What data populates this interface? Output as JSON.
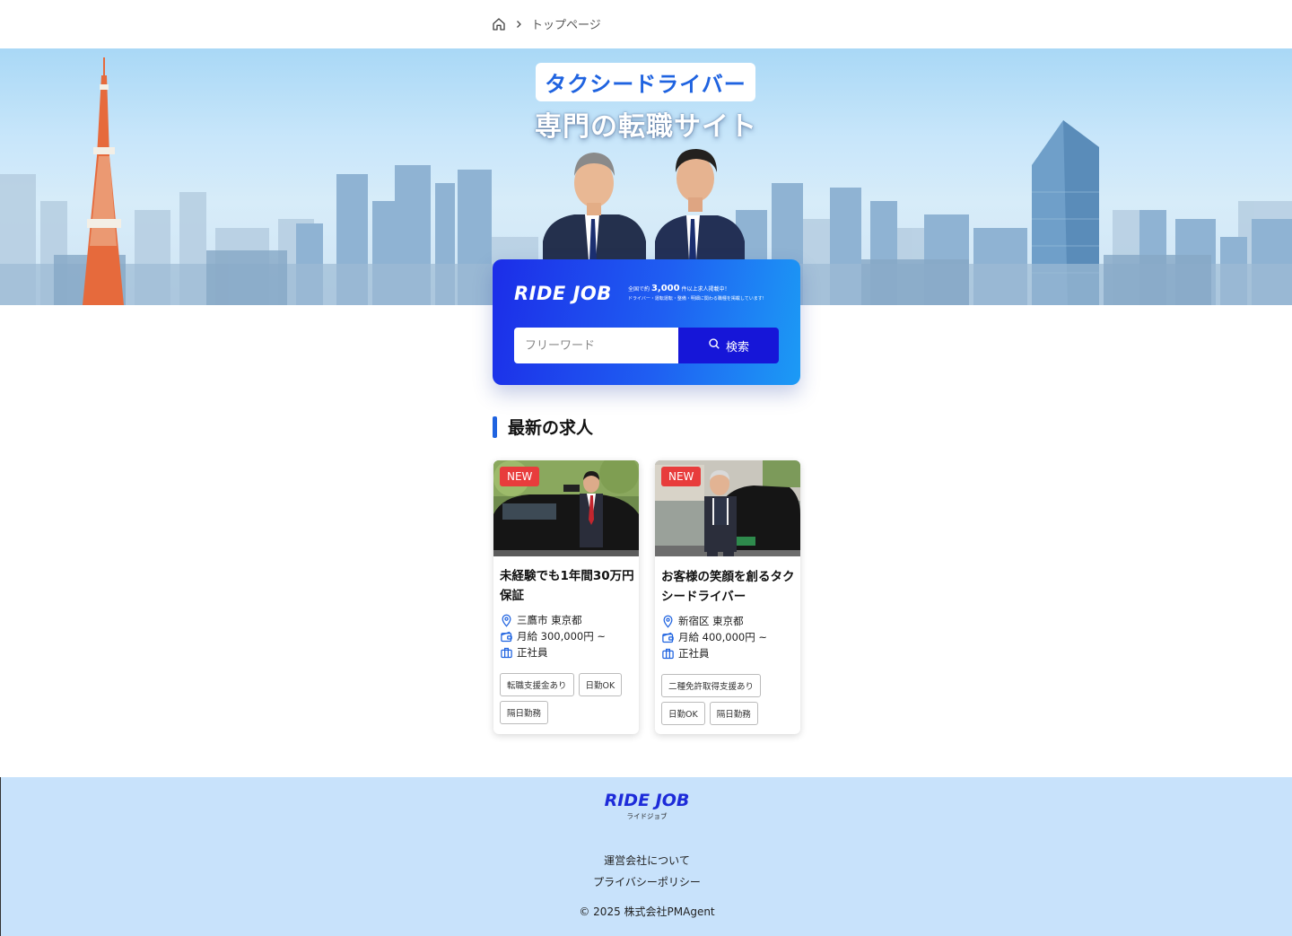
{
  "breadcrumb": {
    "current": "トップページ"
  },
  "hero": {
    "tag": "タクシードライバー",
    "title": "専門の転職サイト"
  },
  "search": {
    "logo": "RIDE JOB",
    "promo_prefix": "全国で約",
    "promo_count": "3,000",
    "promo_suffix": "件以上求人掲載中！",
    "promo_line2": "ドライバー・運転運転・整備・明細に関わる職種を掲載しています!",
    "placeholder": "フリーワード",
    "button": "検索"
  },
  "section": {
    "title": "最新の求人"
  },
  "jobs": [
    {
      "badge": "NEW",
      "title": "未経験でも1年間30万円保証",
      "location": "三鷹市 東京都",
      "salary": "月給 300,000円 ~",
      "type": "正社員",
      "tags": [
        "転職支援金あり",
        "日勤OK",
        "隔日勤務"
      ]
    },
    {
      "badge": "NEW",
      "title": "お客様の笑顔を創るタクシードライバー",
      "location": "新宿区 東京都",
      "salary": "月給 400,000円 ~",
      "type": "正社員",
      "tags": [
        "二種免許取得支援あり",
        "日勤OK",
        "隔日勤務"
      ]
    }
  ],
  "footer": {
    "logo": "RIDE JOB",
    "sub": "ライドジョブ",
    "links": [
      "運営会社について",
      "プライバシーポリシー"
    ],
    "copyright": "© 2025 株式会社PMAgent"
  },
  "colors": {
    "brand": "#1f63e0",
    "button": "#1616d8",
    "badge": "#e83c3c",
    "footer_bg": "#c8e2fb"
  }
}
